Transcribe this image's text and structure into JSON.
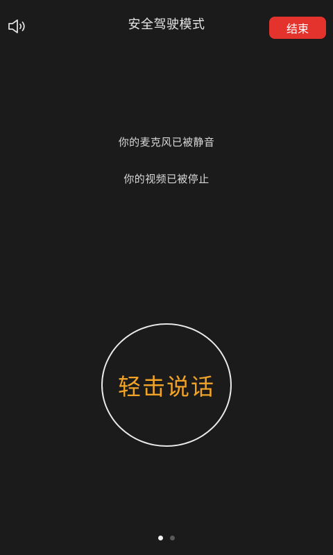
{
  "header": {
    "title": "安全驾驶模式",
    "end_label": "结束",
    "speaker_icon": "speaker-icon"
  },
  "status": {
    "mic_text": "你的麦克风已被静音",
    "video_text": "你的视频已被停止"
  },
  "talk_button": {
    "label": "轻击说话"
  },
  "pagination": {
    "total": 2,
    "active_index": 0
  },
  "colors": {
    "background": "#1b1b1b",
    "end_button": "#e4332d",
    "talk_label": "#f1a327",
    "text": "#d9d9d9"
  }
}
